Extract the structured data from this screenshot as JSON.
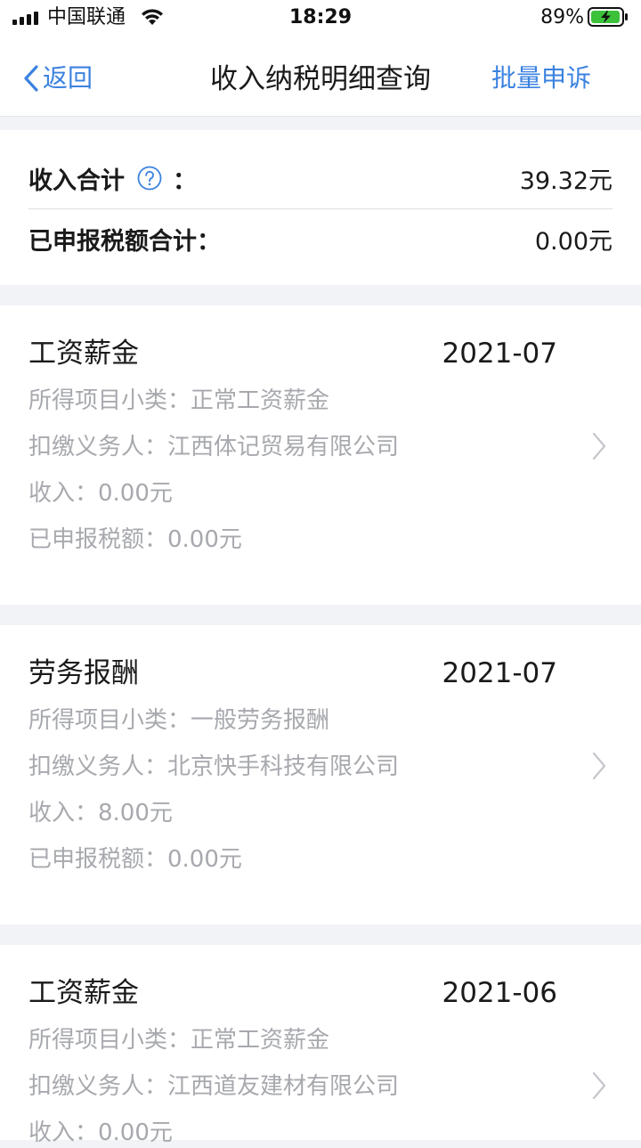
{
  "status_bar": {
    "carrier": "中国联通",
    "time": "18:29",
    "battery_percent": "89%"
  },
  "nav": {
    "back_label": "返回",
    "title": "收入纳税明细查询",
    "action_label": "批量申诉"
  },
  "summary": {
    "income_label": "收入合计",
    "income_colon": "：",
    "income_value": "39.32元",
    "tax_label": "已申报税额合计：",
    "tax_value": "0.00元"
  },
  "records": [
    {
      "title": "工资薪金",
      "date": "2021-07",
      "subcategory": "所得项目小类：正常工资薪金",
      "withholder": "扣缴义务人：江西体记贸易有限公司",
      "income": "收入：0.00元",
      "tax": "已申报税额：0.00元"
    },
    {
      "title": "劳务报酬",
      "date": "2021-07",
      "subcategory": "所得项目小类：一般劳务报酬",
      "withholder": "扣缴义务人：北京快手科技有限公司",
      "income": "收入：8.00元",
      "tax": "已申报税额：0.00元"
    },
    {
      "title": "工资薪金",
      "date": "2021-06",
      "subcategory": "所得项目小类：正常工资薪金",
      "withholder": "扣缴义务人：江西道友建材有限公司",
      "income": "收入：0.00元",
      "tax": ""
    }
  ],
  "colors": {
    "accent": "#3b82e0",
    "page_background": "#f2f3f7",
    "secondary_text": "#a7a9ae",
    "battery_charging": "#3cc13b"
  },
  "icons": {
    "signal": "signal-bars-icon",
    "wifi": "wifi-icon",
    "battery": "battery-charging-icon",
    "back": "chevron-left-icon",
    "help": "question-circle-icon",
    "row_arrow": "chevron-right-icon"
  }
}
